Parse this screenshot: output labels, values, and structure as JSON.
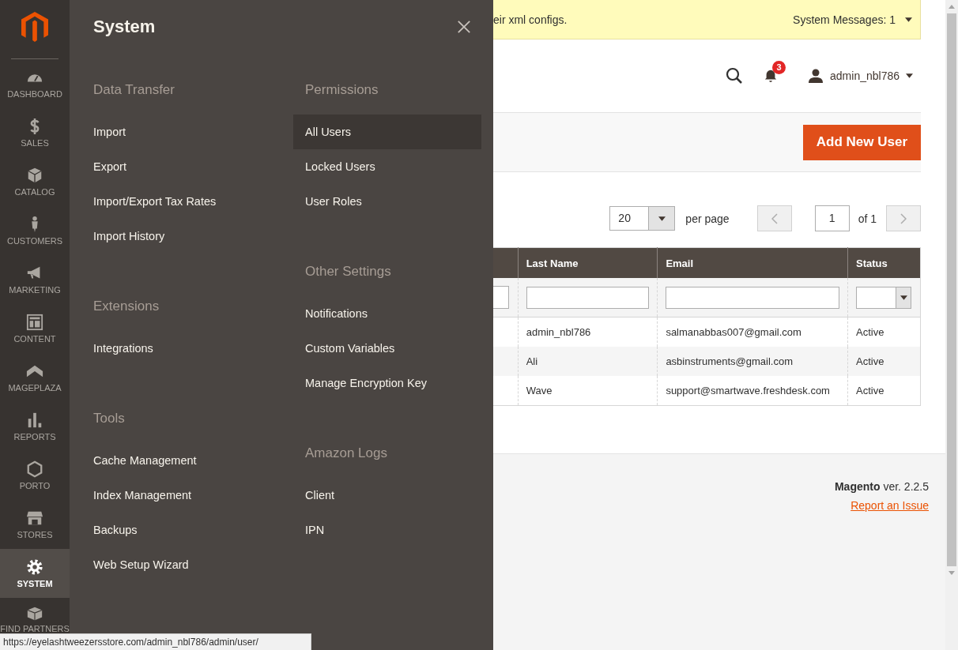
{
  "sidebar": {
    "items": [
      {
        "label": "DASHBOARD",
        "selected": false
      },
      {
        "label": "SALES",
        "selected": false
      },
      {
        "label": "CATALOG",
        "selected": false
      },
      {
        "label": "CUSTOMERS",
        "selected": false
      },
      {
        "label": "MARKETING",
        "selected": false
      },
      {
        "label": "CONTENT",
        "selected": false
      },
      {
        "label": "MAGEPLAZA",
        "selected": false
      },
      {
        "label": "REPORTS",
        "selected": false
      },
      {
        "label": "PORTO",
        "selected": false
      },
      {
        "label": "STORES",
        "selected": false
      },
      {
        "label": "SYSTEM",
        "selected": true
      },
      {
        "label": "FIND PARTNERS",
        "selected": false
      }
    ]
  },
  "flyout": {
    "title": "System",
    "columns": [
      [
        {
          "heading": "Data Transfer",
          "items": [
            {
              "label": "Import",
              "selected": false
            },
            {
              "label": "Export",
              "selected": false
            },
            {
              "label": "Import/Export Tax Rates",
              "selected": false
            },
            {
              "label": "Import History",
              "selected": false
            }
          ]
        },
        {
          "heading": "Extensions",
          "items": [
            {
              "label": "Integrations",
              "selected": false
            }
          ]
        },
        {
          "heading": "Tools",
          "items": [
            {
              "label": "Cache Management",
              "selected": false
            },
            {
              "label": "Index Management",
              "selected": false
            },
            {
              "label": "Backups",
              "selected": false
            },
            {
              "label": "Web Setup Wizard",
              "selected": false
            }
          ]
        }
      ],
      [
        {
          "heading": "Permissions",
          "items": [
            {
              "label": "All Users",
              "selected": true
            },
            {
              "label": "Locked Users",
              "selected": false
            },
            {
              "label": "User Roles",
              "selected": false
            }
          ]
        },
        {
          "heading": "Other Settings",
          "items": [
            {
              "label": "Notifications",
              "selected": false
            },
            {
              "label": "Custom Variables",
              "selected": false
            },
            {
              "label": "Manage Encryption Key",
              "selected": false
            }
          ]
        },
        {
          "heading": "Amazon Logs",
          "items": [
            {
              "label": "Client",
              "selected": false
            },
            {
              "label": "IPN",
              "selected": false
            }
          ]
        }
      ]
    ]
  },
  "message_bar": {
    "text": "eir xml configs.",
    "link": "System Messages: 1"
  },
  "header": {
    "notifications": "3",
    "user": "admin_nbl786"
  },
  "actions": {
    "button": "Add New User"
  },
  "pager": {
    "per_page_value": "20",
    "per_page_label": "per page",
    "page": "1",
    "of": "of 1"
  },
  "table": {
    "columns": [
      "Last Name",
      "Email",
      "Status"
    ],
    "rows": [
      [
        "admin_nbl786",
        "salmanabbas007@gmail.com",
        "Active"
      ],
      [
        "Ali",
        "asbinstruments@gmail.com",
        "Active"
      ],
      [
        "Wave",
        "support@smartwave.freshdesk.com",
        "Active"
      ]
    ]
  },
  "footer": {
    "version": "**Magento** ver. 2.2.5",
    "link": "Report an Issue"
  },
  "status_url": "https://eyelashtweezersstore.com/admin_nbl786/admin/user/"
}
